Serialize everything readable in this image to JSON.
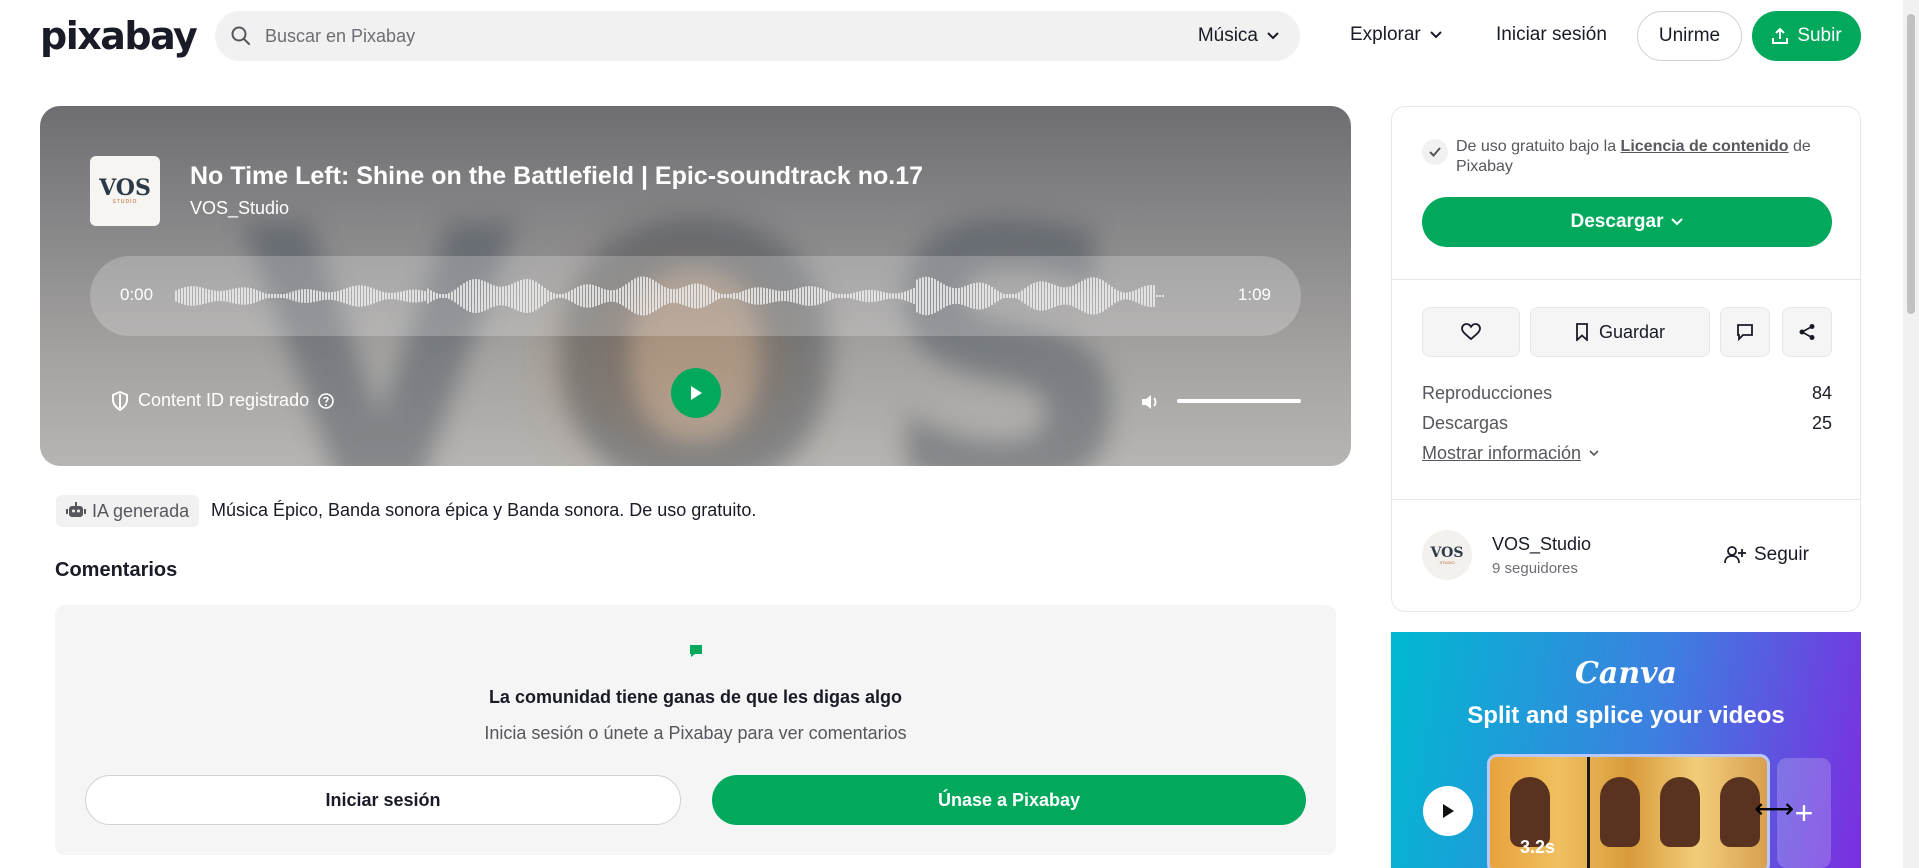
{
  "header": {
    "logo": "pixabay",
    "search_placeholder": "Buscar en Pixabay",
    "search_category": "Música",
    "explore": "Explorar",
    "login": "Iniciar sesión",
    "join": "Unirme",
    "upload": "Subir"
  },
  "player": {
    "title": "No Time Left: Shine on the Battlefield | Epic-soundtrack no.17",
    "artist": "VOS_Studio",
    "thumb_logo": "VOS",
    "thumb_sub": "STUDIO",
    "time_current": "0:00",
    "time_total": "1:09",
    "content_id": "Content ID registrado",
    "volume_level": 1.0,
    "background_letters": "VOS"
  },
  "tags": {
    "ai_badge": "IA generada",
    "description": "Música Épico, Banda sonora épica y Banda sonora. De uso gratuito."
  },
  "comments": {
    "title": "Comentarios",
    "empty_title": "La comunidad tiene ganas de que les digas algo",
    "empty_sub": "Inicia sesión o únete a Pixabay para ver comentarios",
    "login_btn": "Iniciar sesión",
    "join_btn": "Únase a Pixabay"
  },
  "sidebar": {
    "license_pre": "De uso gratuito bajo la ",
    "license_link": "Licencia de contenido",
    "license_post": " de Pixabay",
    "download": "Descargar",
    "save": "Guardar",
    "stats": [
      {
        "label": "Reproducciones",
        "value": "84"
      },
      {
        "label": "Descargas",
        "value": "25"
      }
    ],
    "more_info": "Mostrar información",
    "user": {
      "name": "VOS_Studio",
      "followers": "9 seguidores",
      "avatar_logo": "VOS",
      "avatar_sub": "STUDIO",
      "follow": "Seguir"
    }
  },
  "ad": {
    "brand": "Canva",
    "tagline": "Split and splice your videos",
    "duration": "3.2s",
    "plus": "+"
  },
  "colors": {
    "accent": "#02a95c",
    "text": "#191b26",
    "muted": "#55575d"
  }
}
